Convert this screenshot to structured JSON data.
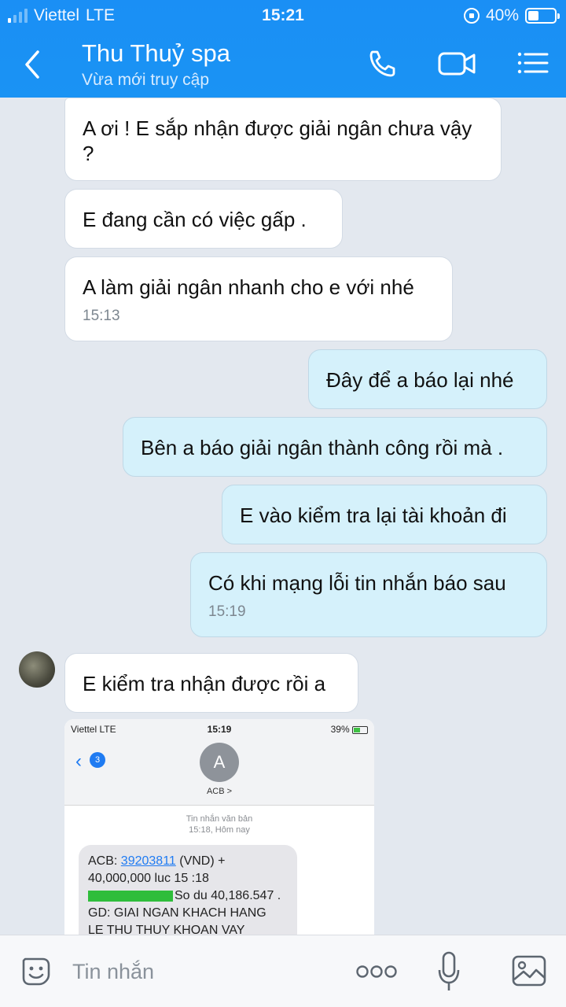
{
  "status_bar": {
    "carrier": "Viettel",
    "network": "LTE",
    "time": "15:21",
    "battery": "40%",
    "battery_level": 0.4
  },
  "header": {
    "title": "Thu Thuỷ spa",
    "subtitle": "Vừa mới truy cập"
  },
  "messages": [
    {
      "side": "in",
      "text": "A ơi ! E sắp nhận được giải ngân chưa vậy ?",
      "time": ""
    },
    {
      "side": "in",
      "text": "E đang cần có việc gấp .",
      "time": ""
    },
    {
      "side": "in",
      "text": "A làm giải ngân nhanh cho e với nhé",
      "time": "15:13"
    },
    {
      "side": "out",
      "text": "Đây để a báo lại nhé",
      "time": ""
    },
    {
      "side": "out",
      "text": "Bên a báo giải ngân thành công rồi mà .",
      "time": ""
    },
    {
      "side": "out",
      "text": "E vào kiểm tra lại tài khoản đi",
      "time": ""
    },
    {
      "side": "out",
      "text": "Có khi mạng lỗi tin nhắn báo sau",
      "time": "15:19"
    },
    {
      "side": "in",
      "text": "E kiểm tra nhận được rồi a",
      "time": ""
    }
  ],
  "shared_image": {
    "status": {
      "carrier": "Viettel LTE",
      "time": "15:19",
      "battery": "39%"
    },
    "back_badge": "3",
    "avatar_letter": "A",
    "contact": "ACB >",
    "meta_line1": "Tin nhắn văn bản",
    "meta_line2": "15:18, Hôm nay",
    "sms": {
      "prefix": "ACB: ",
      "account": "39203811",
      "after_account": " (VND) +",
      "line2": "40,000,000 luc 15 :18",
      "line3": "So du 40,186.547 .",
      "line4": "GD: GIAI NGAN KHACH HANG",
      "line5": "LE THU THUY KHOAN VAY"
    }
  },
  "input_bar": {
    "placeholder": "Tin nhắn"
  }
}
